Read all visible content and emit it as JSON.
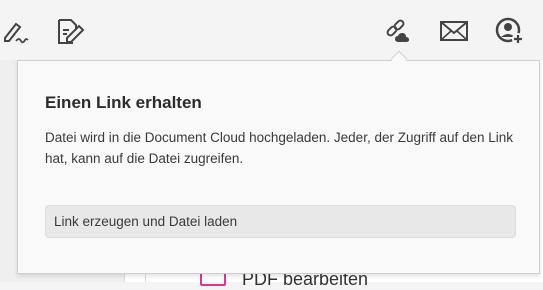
{
  "toolbar": {
    "left_icons": [
      "signature-icon",
      "edit-document-icon"
    ],
    "right_icons": [
      "share-link-cloud-icon",
      "mail-icon",
      "add-user-icon"
    ]
  },
  "background": {
    "item_label": "PDF bearbeiten",
    "item_icon_color": "#d6398e"
  },
  "popover": {
    "title": "Einen Link erhalten",
    "description": "Datei wird in die Document Cloud hochgeladen. Jeder, der Zugriff auf den Link hat, kann auf die Datei zugreifen.",
    "button_label": "Link erzeugen und Datei laden"
  }
}
